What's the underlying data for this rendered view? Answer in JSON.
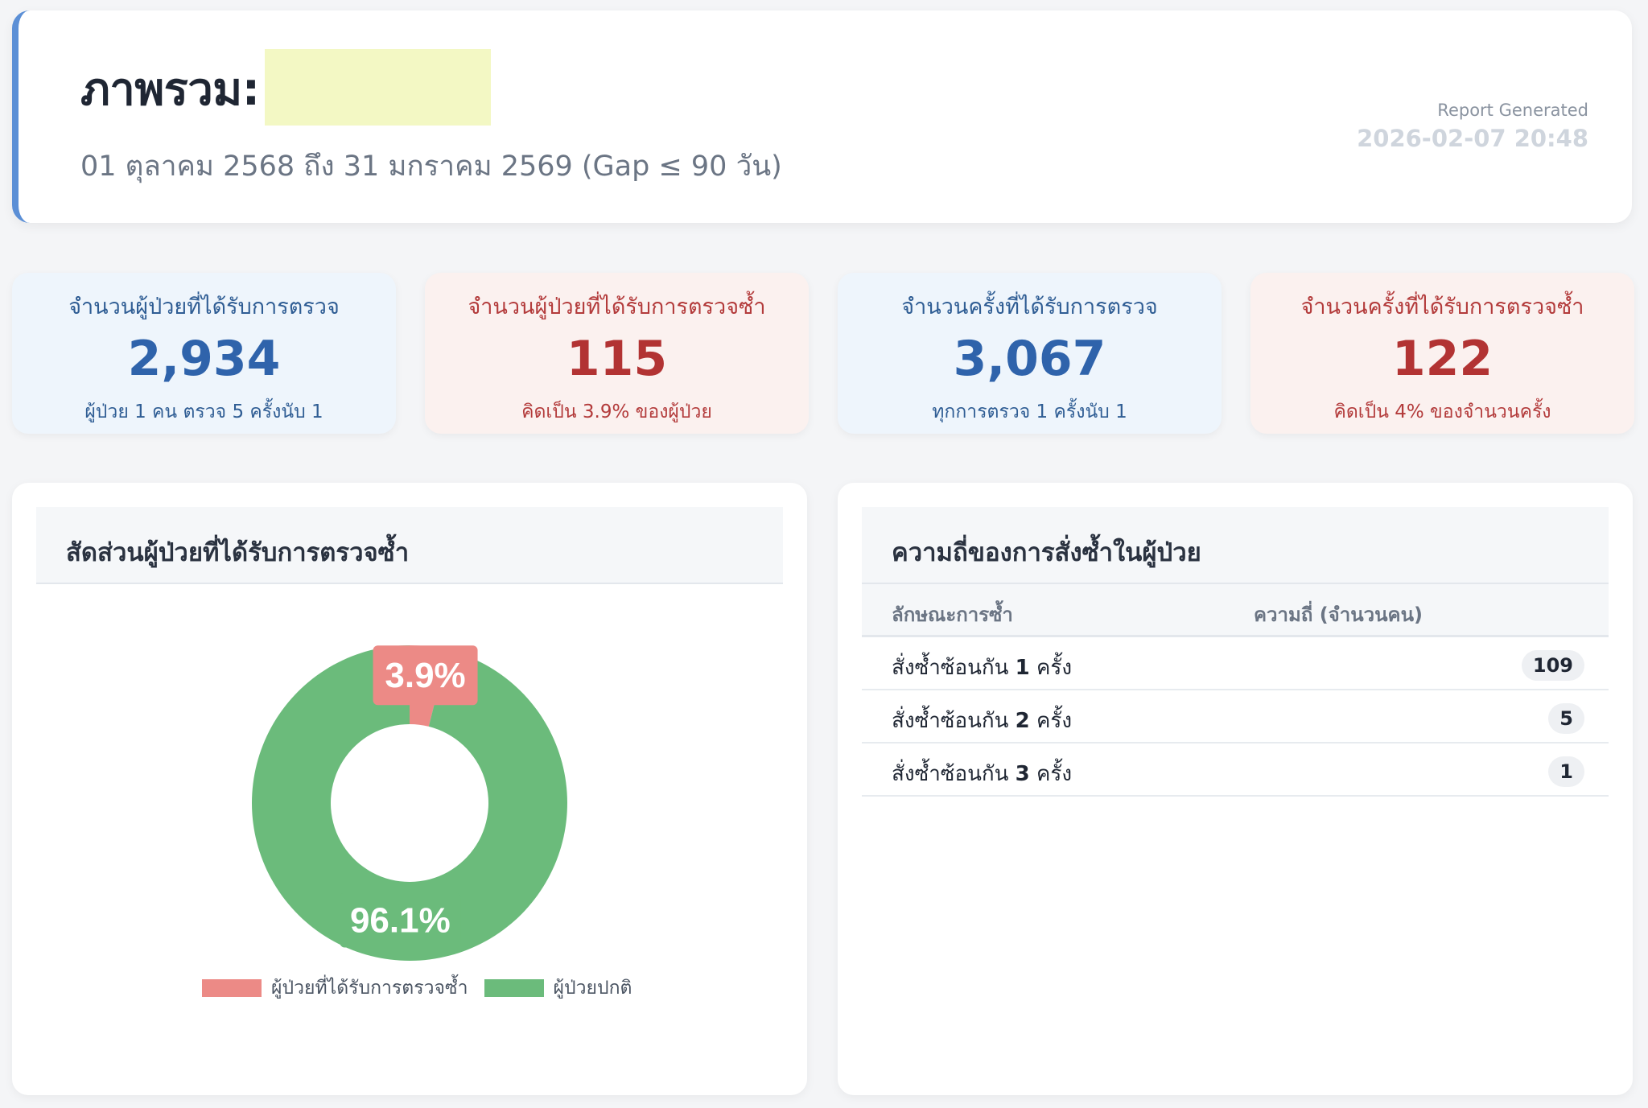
{
  "header": {
    "title": "ภาพรวม:",
    "subtitle": "01 ตุลาคม 2568 ถึง 31 มกราคม 2569 (Gap ≤ 90 วัน)",
    "report_label": "Report Generated",
    "report_time": "2026-02-07 20:48"
  },
  "stats": [
    {
      "title": "จำนวนผู้ป่วยที่ได้รับการตรวจ",
      "value": "2,934",
      "note": "ผู้ป่วย 1 คน ตรวจ 5 ครั้งนับ 1",
      "theme": "blue"
    },
    {
      "title": "จำนวนผู้ป่วยที่ได้รับการตรวจซ้ำ",
      "value": "115",
      "note": "คิดเป็น 3.9% ของผู้ป่วย",
      "theme": "red"
    },
    {
      "title": "จำนวนครั้งที่ได้รับการตรวจ",
      "value": "3,067",
      "note": "ทุกการตรวจ 1 ครั้งนับ 1",
      "theme": "blue"
    },
    {
      "title": "จำนวนครั้งที่ได้รับการตรวจซ้ำ",
      "value": "122",
      "note": "คิดเป็น 4% ของจำนวนครั้ง",
      "theme": "red"
    }
  ],
  "donut_panel": {
    "title": "สัดส่วนผู้ป่วยที่ได้รับการตรวจซ้ำ"
  },
  "chart_data": {
    "type": "pie",
    "categories": [
      "ผู้ป่วยที่ได้รับการตรวจซ้ำ",
      "ผู้ป่วยปกติ"
    ],
    "values": [
      3.9,
      96.1
    ],
    "data_labels": [
      "3.9%",
      "96.1%"
    ],
    "colors": [
      "#ec8a86",
      "#6bbb7b"
    ],
    "legend_position": "bottom",
    "title": ""
  },
  "freq_panel": {
    "title": "ความถี่ของการสั่งซ้ำในผู้ป่วย",
    "col1": "ลักษณะการซ้ำ",
    "col2": "ความถี่ (จำนวนคน)",
    "rows": [
      {
        "prefix": "สั่งซ้ำซ้อนกัน ",
        "num": "1",
        "suffix": " ครั้ง",
        "count": "109"
      },
      {
        "prefix": "สั่งซ้ำซ้อนกัน ",
        "num": "2",
        "suffix": " ครั้ง",
        "count": "5"
      },
      {
        "prefix": "สั่งซ้ำซ้อนกัน ",
        "num": "3",
        "suffix": " ครั้ง",
        "count": "1"
      }
    ]
  },
  "colors": {
    "accent": "#5b8fd6",
    "blue_value": "#2f63ab",
    "red_value": "#b23333",
    "repeat_slice": "#ec8a86",
    "normal_slice": "#6bbb7b"
  }
}
